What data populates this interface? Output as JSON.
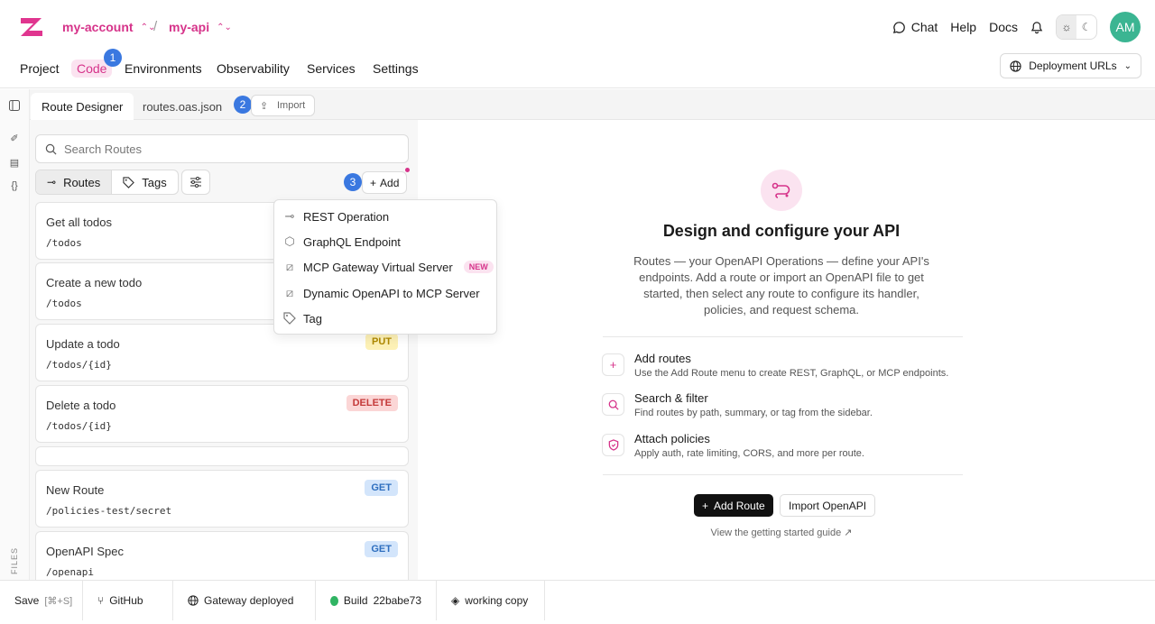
{
  "header": {
    "account": "my-account",
    "api": "my-api",
    "sep": "/",
    "chat": "Chat",
    "help": "Help",
    "docs": "Docs",
    "avatar": "AM"
  },
  "nav": {
    "items": [
      "Project",
      "Code",
      "Environments",
      "Observability",
      "Services",
      "Settings"
    ],
    "badge": "1",
    "deployment_urls": "Deployment URLs"
  },
  "tabs": {
    "route_designer": "Route Designer",
    "routes_file": "routes.oas.json",
    "badge": "2",
    "import": "Import"
  },
  "sidebar": {
    "search_placeholder": "Search Routes",
    "routes": "Routes",
    "tags": "Tags",
    "badge": "3",
    "add": "Add",
    "rail_files": "FILES"
  },
  "routes": [
    {
      "title": "Get all todos",
      "path": "/todos",
      "method": ""
    },
    {
      "title": "Create a new todo",
      "path": "/todos",
      "method": ""
    },
    {
      "title": "Update a todo",
      "path": "/todos/{id}",
      "method": "PUT"
    },
    {
      "title": "Delete a todo",
      "path": "/todos/{id}",
      "method": "DELETE"
    },
    {
      "title": "New Route",
      "path": "/policies-test/secret",
      "method": "GET"
    },
    {
      "title": "OpenAPI Spec",
      "path": "/openapi",
      "method": "GET"
    }
  ],
  "add_menu": {
    "items": [
      "REST Operation",
      "GraphQL Endpoint",
      "MCP Gateway Virtual Server",
      "Dynamic OpenAPI to MCP Server",
      "Tag"
    ],
    "new_badge": "NEW"
  },
  "main": {
    "title": "Design and configure your API",
    "description": "Routes — your OpenAPI Operations — define your API's endpoints. Add a route or import an OpenAPI file to get started, then select any route to configure its handler, policies, and request schema.",
    "features": [
      {
        "title": "Add routes",
        "desc": "Use the Add Route menu to create REST, GraphQL, or MCP endpoints."
      },
      {
        "title": "Search & filter",
        "desc": "Find routes by path, summary, or tag from the sidebar."
      },
      {
        "title": "Attach policies",
        "desc": "Apply auth, rate limiting, CORS, and more per route."
      }
    ],
    "add_route": "Add Route",
    "import_openapi": "Import OpenAPI",
    "guide": "View the getting started guide"
  },
  "statusbar": {
    "save": "Save",
    "save_shortcut": "[⌘+S]",
    "github": "GitHub",
    "gateway": "Gateway deployed",
    "build_label": "Build",
    "build_id": "22babe73",
    "working_copy": "working copy"
  },
  "colors": {
    "brand": "#d6338a",
    "badge_blue": "#3a78e0",
    "avatar": "#3bb592"
  }
}
